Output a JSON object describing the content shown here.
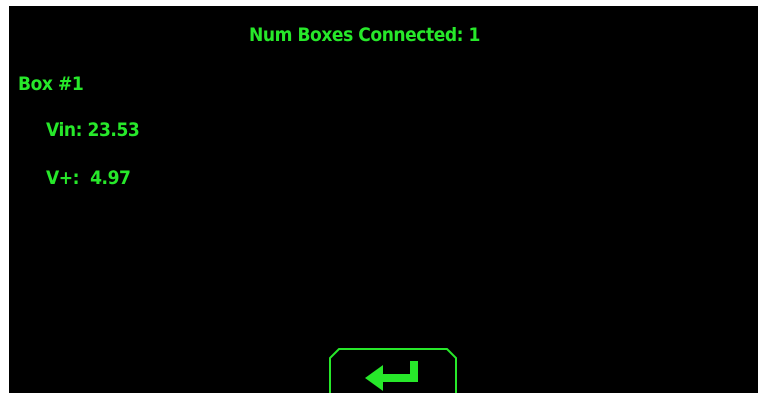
{
  "header": {
    "title": "Num Boxes Connected: 1"
  },
  "boxes": [
    {
      "label": "Box #1",
      "vin_label": "Vin:",
      "vin_value": "23.53",
      "vplus_label": "V+:",
      "vplus_value": "4.97"
    }
  ],
  "buttons": {
    "enter_icon": "enter-return-arrow-icon"
  },
  "colors": {
    "background": "#000000",
    "text": "#27e82a",
    "frame": "#ffffff"
  }
}
